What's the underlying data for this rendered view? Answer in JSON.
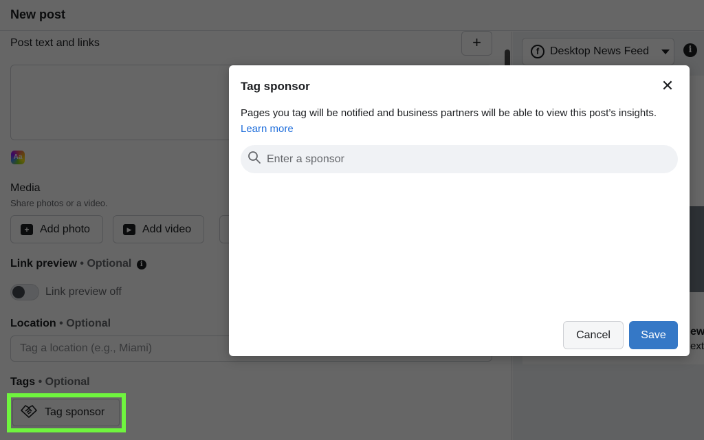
{
  "header": {
    "title": "New post"
  },
  "left_panel": {
    "post_text_label": "Post text and links",
    "add_button_label": "+",
    "text_style_icon_label": "Aa",
    "media": {
      "label": "Media",
      "sublabel": "Share photos or a video.",
      "buttons": [
        {
          "label": "Add photo",
          "icon": "add-photo-icon",
          "glyph": "+"
        },
        {
          "label": "Add video",
          "icon": "add-video-icon",
          "glyph": "▶"
        }
      ]
    },
    "link_preview": {
      "label": "Link preview",
      "separator": "•",
      "optional": "Optional",
      "info_glyph": "i",
      "toggle_label": "Link preview off",
      "toggle_on": false
    },
    "location": {
      "label": "Location",
      "separator": "•",
      "optional": "Optional",
      "placeholder": "Tag a location (e.g., Miami)",
      "value": ""
    },
    "tags": {
      "label": "Tags",
      "separator": "•",
      "optional": "Optional",
      "tag_sponsor_label": "Tag sponsor"
    }
  },
  "right_panel": {
    "placement_label": "Desktop News Feed",
    "fb_glyph": "f",
    "info_glyph": "i",
    "preview_title_fragment": "ew",
    "preview_sub_fragment": "ext"
  },
  "modal": {
    "title": "Tag sponsor",
    "close_glyph": "✕",
    "description": "Pages you tag will be notified and business partners will be able to view this post’s insights. ",
    "learn_more": "Learn more",
    "search_placeholder": "Enter a sponsor",
    "search_value": "",
    "cancel_label": "Cancel",
    "save_label": "Save"
  },
  "colors": {
    "highlight": "#6ff53e",
    "primary_button": "#3578c6",
    "link": "#216fdb"
  }
}
